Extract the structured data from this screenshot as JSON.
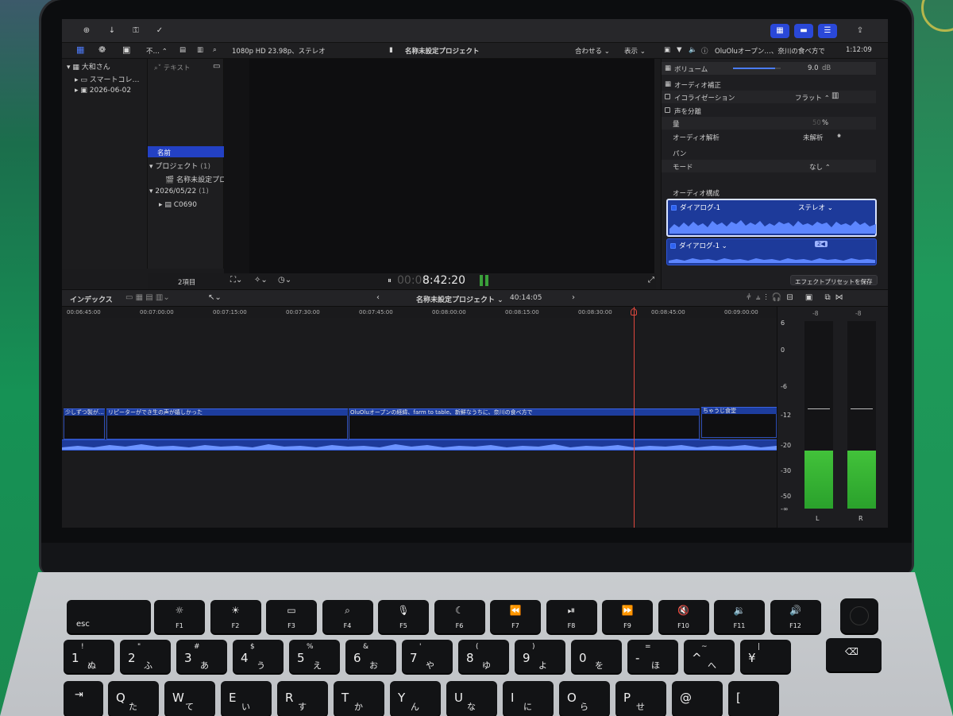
{
  "toolbar": {
    "share_icon": "share-icon"
  },
  "library": {
    "folder": "不…",
    "format": "1080p HD 23.98p、ステレオ",
    "items": [
      {
        "label": "大和さん"
      },
      {
        "label": "スマートコレ…"
      },
      {
        "label": "2026-06-02"
      }
    ]
  },
  "browser": {
    "search_placeholder": "テキスト",
    "column_header": "名前",
    "groups": [
      {
        "label": "プロジェクト",
        "count": "(1)",
        "child": "名称未設定プロ"
      },
      {
        "label": "2026/05/22",
        "count": "(1)",
        "child": "C0690"
      }
    ],
    "item_count": "2項目"
  },
  "viewer": {
    "project_title": "名称未設定プロジェクト",
    "fit_label": "合わせる",
    "view_label": "表示",
    "timecode_dim": "00:00",
    "timecode": "8:42:20"
  },
  "inspector": {
    "clip_title": "OluOluオープン…、奈川の食べ方で",
    "duration": "1:12:09",
    "volume_label": "ボリューム",
    "volume_value": "9.0",
    "volume_unit": "dB",
    "volume_level": 0.88,
    "enhance_header": "オーディオ補正",
    "eq_label": "イコライゼーション",
    "eq_value": "フラット",
    "voice_label": "声を分離",
    "amount_label": "量",
    "amount_value": "50",
    "amount_unit": "%",
    "analysis_label": "オーディオ解析",
    "analysis_value": "未解析",
    "pan_header": "パン",
    "mode_label": "モード",
    "mode_value": "なし",
    "config_header": "オーディオ構成",
    "components": [
      {
        "name": "ダイアログ-1",
        "channel": "ステレオ"
      },
      {
        "name": "ダイアログ-1",
        "channel": "2"
      }
    ],
    "save_preset": "エフェクトプリセットを保存"
  },
  "timeline": {
    "index_label": "インデックス",
    "project_title": "名称未設定プロジェクト",
    "duration": "40:14:05",
    "ruler": [
      "00:06:45:00",
      "00:07:00:00",
      "00:07:15:00",
      "00:07:30:00",
      "00:07:45:00",
      "00:08:00:00",
      "00:08:15:00",
      "00:08:30:00",
      "00:08:45:00",
      "00:09:00:00"
    ],
    "captions": [
      {
        "text": "少しずつ製が…"
      },
      {
        "text": "リピーターができ生の声が嬉しかった"
      },
      {
        "text": "OluOluオープンの経緯、farm to table、新鮮なうちに、奈川の食べ方で"
      },
      {
        "text": "ちゃうじ食堂"
      }
    ]
  },
  "meters": {
    "top_labels": [
      "-8",
      "-8"
    ],
    "scale": [
      "6",
      "0",
      "-6",
      "-12",
      "-20",
      "-30",
      "-50",
      "-∞"
    ],
    "channels": [
      "L",
      "R"
    ],
    "levels": [
      0.31,
      0.31
    ],
    "peaks": [
      0.53,
      0.53
    ]
  },
  "keyboard": {
    "esc": "esc",
    "fn_keys": [
      {
        "label": "F1",
        "icon": "brightness-down-icon",
        "glyph": "☼"
      },
      {
        "label": "F2",
        "icon": "brightness-up-icon",
        "glyph": "☀"
      },
      {
        "label": "F3",
        "icon": "mission-control-icon",
        "glyph": "▭"
      },
      {
        "label": "F4",
        "icon": "spotlight-icon",
        "glyph": "⌕"
      },
      {
        "label": "F5",
        "icon": "dictation-icon",
        "glyph": "🎙"
      },
      {
        "label": "F6",
        "icon": "do-not-disturb-icon",
        "glyph": "☾"
      },
      {
        "label": "F7",
        "icon": "rewind-icon",
        "glyph": "⏪"
      },
      {
        "label": "F8",
        "icon": "play-pause-icon",
        "glyph": "⏯"
      },
      {
        "label": "F9",
        "icon": "fast-forward-icon",
        "glyph": "⏩"
      },
      {
        "label": "F10",
        "icon": "mute-icon",
        "glyph": "🔇"
      },
      {
        "label": "F11",
        "icon": "volume-down-icon",
        "glyph": "🔉"
      },
      {
        "label": "F12",
        "icon": "volume-up-icon",
        "glyph": "🔊"
      }
    ],
    "num_row": [
      {
        "top": "!",
        "main": "1",
        "kana": "ぬ"
      },
      {
        "top": "\"",
        "main": "2",
        "kana": "ふ"
      },
      {
        "top": "#",
        "main": "3",
        "kana": "あ"
      },
      {
        "top": "$",
        "main": "4",
        "kana": "う"
      },
      {
        "top": "%",
        "main": "5",
        "kana": "え"
      },
      {
        "top": "&",
        "main": "6",
        "kana": "お"
      },
      {
        "top": "'",
        "main": "7",
        "kana": "や"
      },
      {
        "top": "(",
        "main": "8",
        "kana": "ゆ"
      },
      {
        "top": ")",
        "main": "9",
        "kana": "よ"
      },
      {
        "top": "",
        "main": "0",
        "kana": "を"
      },
      {
        "top": "=",
        "main": "-",
        "kana": "ほ"
      },
      {
        "top": "~",
        "main": "^",
        "kana": "へ"
      },
      {
        "top": "|",
        "main": "¥",
        "kana": ""
      }
    ],
    "q_row": [
      {
        "main": "Q",
        "kana": "た"
      },
      {
        "main": "W",
        "kana": "て"
      },
      {
        "main": "E",
        "kana": "い"
      },
      {
        "main": "R",
        "kana": "す"
      },
      {
        "main": "T",
        "kana": "か"
      },
      {
        "main": "Y",
        "kana": "ん"
      },
      {
        "main": "U",
        "kana": "な"
      },
      {
        "main": "I",
        "kana": "に"
      },
      {
        "main": "O",
        "kana": "ら"
      },
      {
        "main": "P",
        "kana": "せ"
      },
      {
        "main": "@",
        "kana": ""
      },
      {
        "main": "[",
        "kana": ""
      }
    ]
  }
}
